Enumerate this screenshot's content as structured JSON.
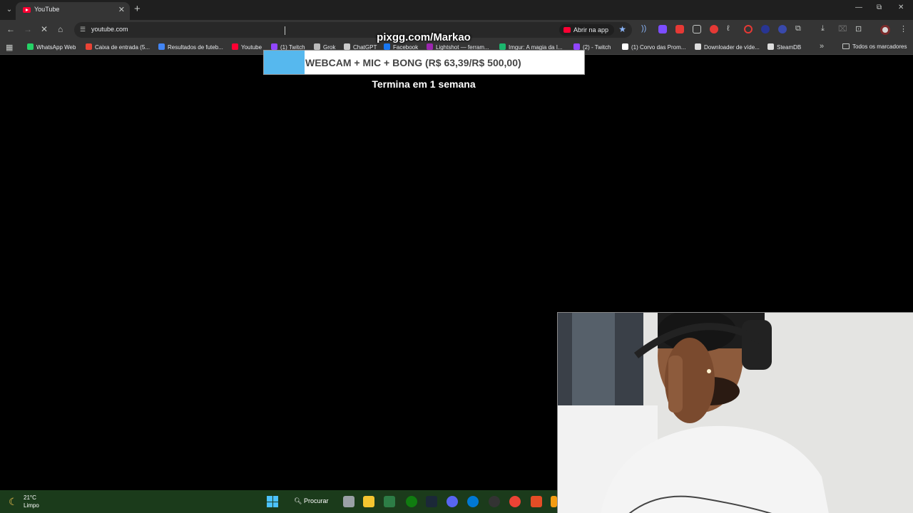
{
  "browser": {
    "tab": {
      "title": "YouTube"
    },
    "window_controls": {
      "minimize": "—",
      "restore": "⧉",
      "close": "✕"
    },
    "omnibox": {
      "url": "youtube.com",
      "open_in_app": "Abrir na app"
    }
  },
  "bookmarks": {
    "items": [
      {
        "label": "WhatsApp Web",
        "color": "#25d366"
      },
      {
        "label": "Caixa de entrada (5...",
        "color": "#ea4335"
      },
      {
        "label": "Resultados de futeb...",
        "color": "#4285f4"
      },
      {
        "label": "Youtube",
        "color": "#ff0033"
      },
      {
        "label": "(1) Twitch",
        "color": "#9146ff"
      },
      {
        "label": "Grok",
        "color": "#bbbbbb"
      },
      {
        "label": "ChatGPT",
        "color": "#cccccc"
      },
      {
        "label": "Facebook",
        "color": "#1877f2"
      },
      {
        "label": "Lightshot — ferram...",
        "color": "#9c27b0"
      },
      {
        "label": "Imgur: A magia da I...",
        "color": "#1bb76e"
      },
      {
        "label": "(2) - Twitch",
        "color": "#9146ff"
      },
      {
        "label": "(1) Corvo das Prom...",
        "color": "#ffffff"
      },
      {
        "label": "Downloader de víde...",
        "color": "#dddddd"
      },
      {
        "label": "SteamDB",
        "color": "#dddddd"
      }
    ],
    "all_bookmarks": "Todos os marcadores"
  },
  "overlay": {
    "donation_url": "pixgg.com/Markao",
    "goal": {
      "text": "WEBCAM + MIC + BONG (R$ 63,39/R$ 500,00)",
      "current": 63.39,
      "target": 500.0,
      "fill_color": "#56b8ee"
    },
    "ends_in": "Termina em 1 semana"
  },
  "taskbar": {
    "weather_temp": "21°C",
    "weather_cond": "Limpo",
    "search_label": "Procurar"
  }
}
